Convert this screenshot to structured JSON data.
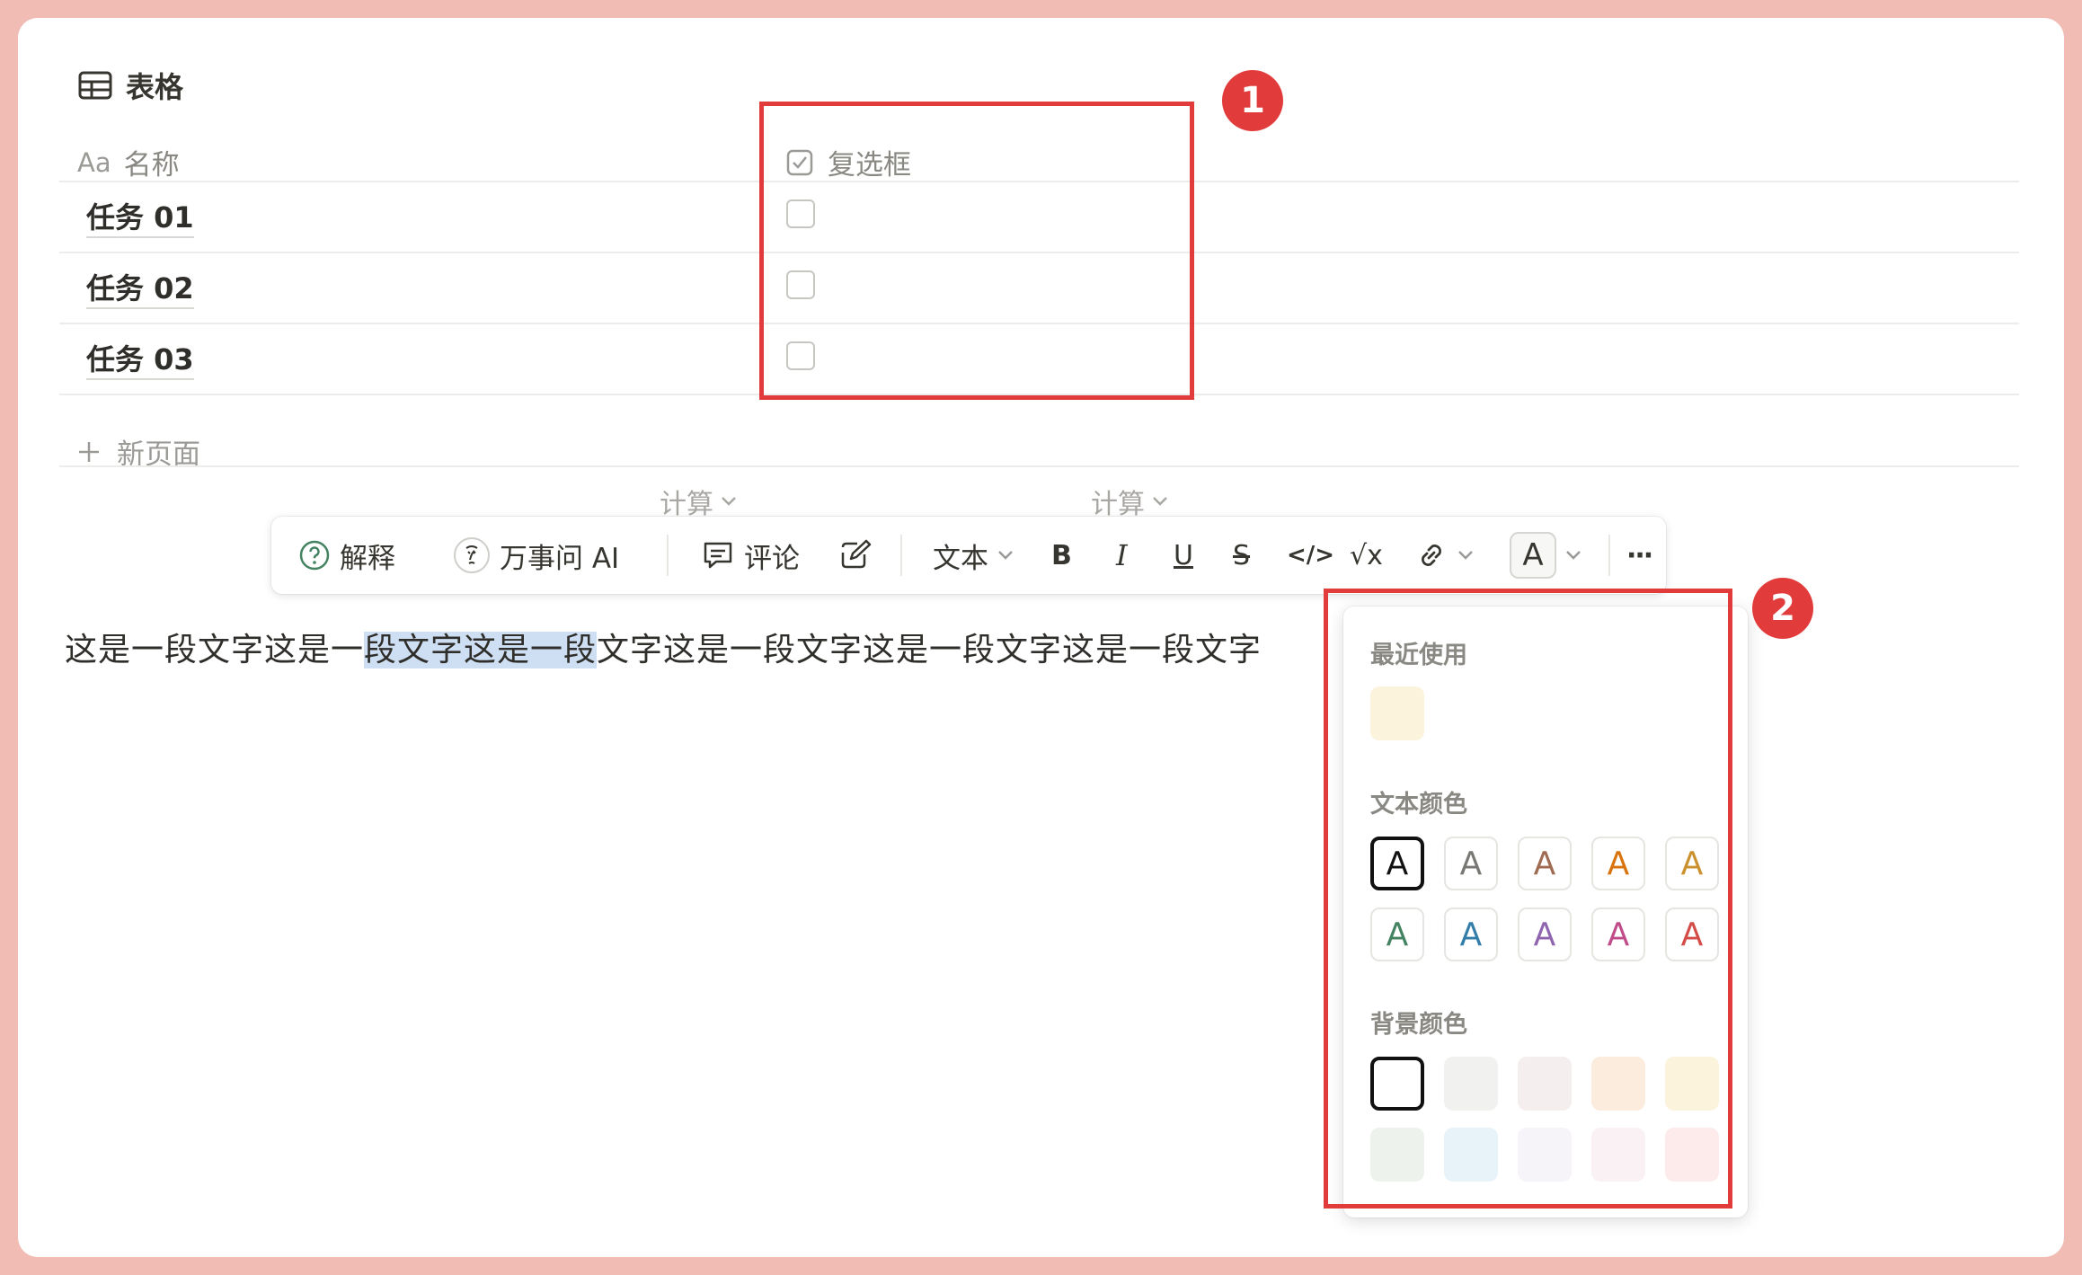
{
  "table": {
    "title": "表格",
    "col_name_prefix": "Aa",
    "col_name": "名称",
    "col_checkbox": "复选框",
    "rows": [
      {
        "name": "任务 01",
        "checked": false
      },
      {
        "name": "任务 02",
        "checked": false
      },
      {
        "name": "任务 03",
        "checked": false
      }
    ],
    "new_page": "新页面",
    "calc_1": "计算",
    "calc_2": "计算"
  },
  "toolbar": {
    "explain": "解释",
    "ask_ai": "万事问 AI",
    "comment": "评论",
    "text_type": "文本",
    "bold": "B",
    "italic": "I",
    "underline": "U",
    "strike": "S",
    "code": "</>",
    "math": "√x",
    "color_letter": "A",
    "more": "···"
  },
  "paragraph": {
    "before": "这是一段文字这是一",
    "selected": "段文字这是一段",
    "after": "文字这是一段文字这是一段文字这是一段文字"
  },
  "color_panel": {
    "recent_label": "最近使用",
    "text_color_label": "文本颜色",
    "bg_color_label": "背景颜色",
    "swatch_letter": "A",
    "recent": [
      "#fbf3db"
    ],
    "text_colors": [
      "#111111",
      "#787774",
      "#9f6b53",
      "#d9730d",
      "#cb912f",
      "#448361",
      "#337ea9",
      "#9065b0",
      "#c14c8a",
      "#d44c47"
    ],
    "bg_colors": [
      "#ffffff",
      "#f1f1ef",
      "#f4eeee",
      "#fbecdd",
      "#fbf3db",
      "#edf3ec",
      "#e7f3f8",
      "#f6f3f9",
      "#faf1f5",
      "#fdebec"
    ]
  },
  "annotations": {
    "badge_1": "1",
    "badge_2": "2"
  },
  "colors": {
    "annotation_red": "#e23b3b",
    "selection": "#cfdff3",
    "page_bg": "#f1bcb3"
  }
}
